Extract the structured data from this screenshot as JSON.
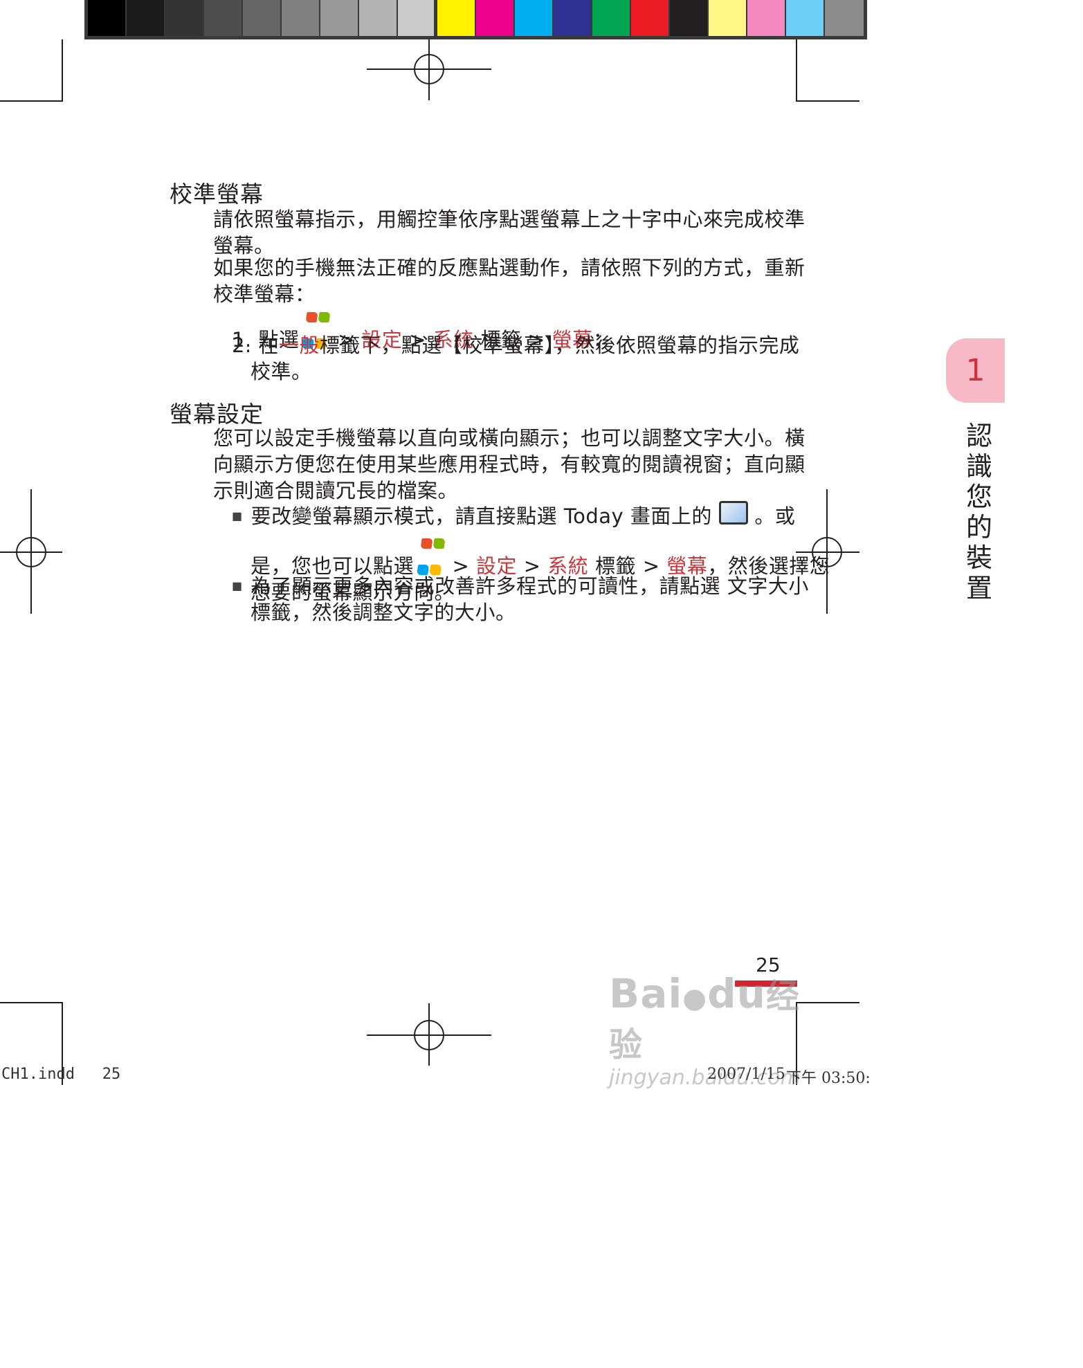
{
  "color_bars": {
    "grays": [
      "#000000",
      "#1b1b1b",
      "#333333",
      "#4d4d4d",
      "#666666",
      "#808080",
      "#999999",
      "#b3b3b3",
      "#cccccc",
      "#e6e6e6",
      "#ffffff"
    ],
    "colors": [
      "#fff200",
      "#ec008c",
      "#00aeef",
      "#2e3192",
      "#00a651",
      "#ed1c24",
      "#231f20",
      "#fff685",
      "#f58ac0",
      "#6dcff6",
      "#8c8c8c"
    ]
  },
  "section1": {
    "title": "校準螢幕",
    "para1": [
      "請依照螢幕指示，用觸控筆依序點選螢幕上之十字中心來完成校準",
      "螢幕。"
    ],
    "para2": [
      "如果您的手機無法正確的反應點選動作，請依照下列的方式，重新",
      "校準螢幕："
    ],
    "step1": {
      "num": "1.",
      "lead": "點選",
      "sep1": ">",
      "settings": "設定",
      "sep2": ">",
      "system": "系統",
      "tab": "標籤",
      "sep3": ">",
      "screen": "螢幕",
      "end": "；"
    },
    "step2": {
      "num": "2.",
      "pre": "在",
      "general": "一般",
      "rest": "標籤下，點選【校準螢幕】，然後依照螢幕的指示完成",
      "line2": "校準。"
    }
  },
  "section2": {
    "title": "螢幕設定",
    "para": [
      "您可以設定手機螢幕以直向或橫向顯示；也可以調整文字大小。橫",
      "向顯示方便您在使用某些應用程式時，有較寬的閱讀視窗；直向顯",
      "示則適合閱讀冗長的檔案。"
    ],
    "bullet1": {
      "line1_pre": "要改變螢幕顯示模式，請直接點選 Today 畫面上的",
      "line1_post": "。或",
      "line2_pre": "是，您也可以點選",
      "sep1": ">",
      "settings": "設定",
      "sep2": ">",
      "system": "系統",
      "tab": "標籤",
      "sep3": ">",
      "screen": "螢幕",
      "line2_post": "，然後選擇您",
      "line3": "想要的螢幕顯示方向。"
    },
    "bullet2": {
      "line1": "為了顯示更多內容或改善許多程式的可讀性，請點選 文字大小",
      "line2": "標籤，然後調整文字的大小。"
    }
  },
  "chapter_tab": {
    "number": "1",
    "title_chars": [
      "認",
      "識",
      "您",
      "的",
      "裝",
      "置"
    ]
  },
  "page_number": "25",
  "watermark": {
    "brand": "Bai",
    "brand2": "du",
    "brand3": "经验",
    "url": "jingyan.baidu.com"
  },
  "slug": {
    "file": "CH1.indd",
    "page": "25",
    "date": "2007/1/15",
    "time": "下午 03:50:"
  }
}
